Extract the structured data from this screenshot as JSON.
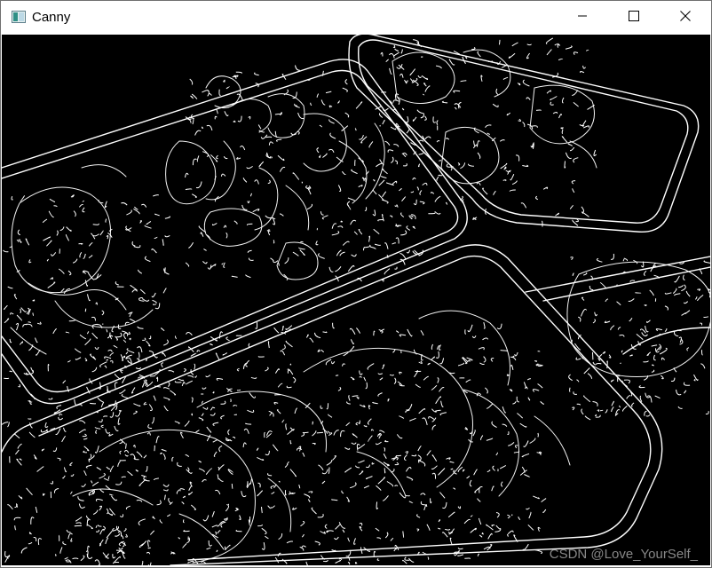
{
  "window": {
    "title": "Canny",
    "icons": {
      "app": "image-window-icon",
      "minimize": "minimize-icon",
      "maximize": "maximize-icon",
      "close": "close-icon"
    }
  },
  "canvas": {
    "description_icon": "canny-edge-image",
    "watermark": "CSDN @Love_YourSelf_"
  },
  "colors": {
    "edge": "#ffffff",
    "background": "#000000",
    "titlebar": "#ffffff"
  }
}
